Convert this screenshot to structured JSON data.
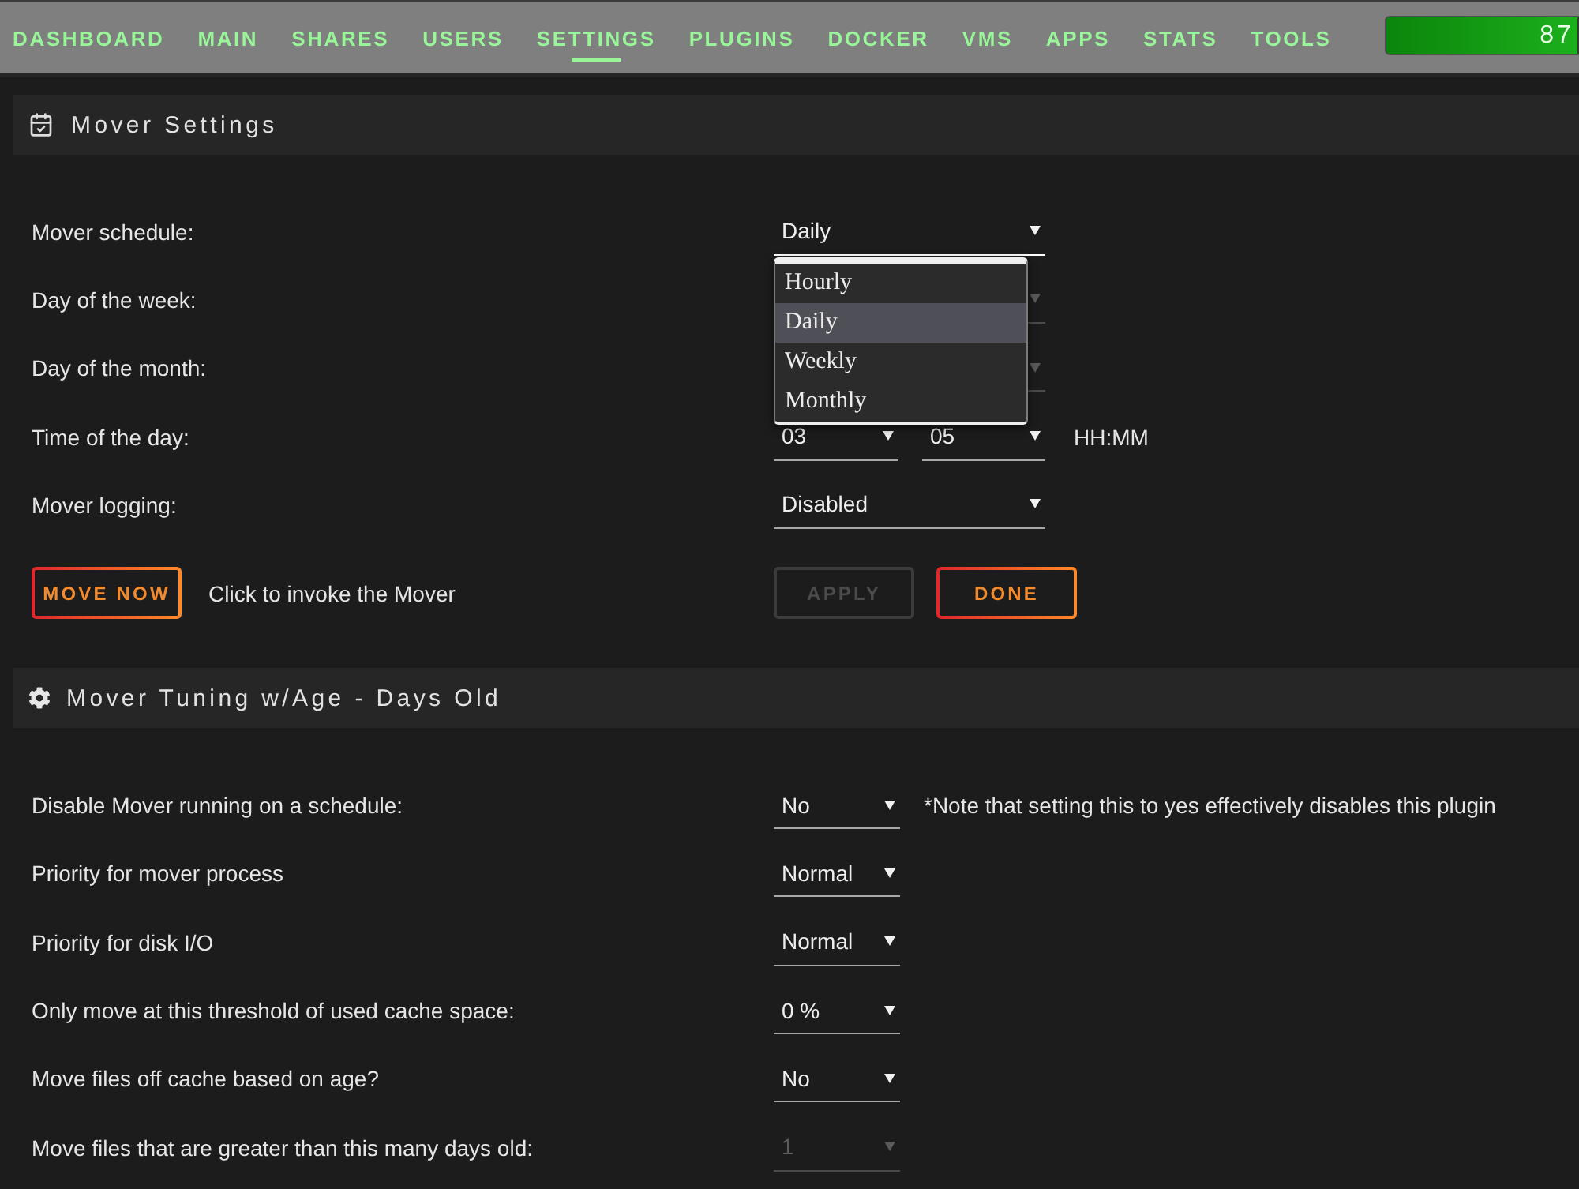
{
  "nav": {
    "items": [
      {
        "label": "DASHBOARD",
        "selected": false
      },
      {
        "label": "MAIN",
        "selected": false
      },
      {
        "label": "SHARES",
        "selected": false
      },
      {
        "label": "USERS",
        "selected": false
      },
      {
        "label": "SETTINGS",
        "selected": true
      },
      {
        "label": "PLUGINS",
        "selected": false
      },
      {
        "label": "DOCKER",
        "selected": false
      },
      {
        "label": "VMS",
        "selected": false
      },
      {
        "label": "APPS",
        "selected": false
      },
      {
        "label": "STATS",
        "selected": false
      },
      {
        "label": "TOOLS",
        "selected": false
      }
    ],
    "meter": {
      "label": "87",
      "level": 0.87
    }
  },
  "mover_settings": {
    "title": "Mover Settings",
    "rows": [
      {
        "kind": "select",
        "label": "Mover schedule:",
        "value": "Daily",
        "disabled": false,
        "expanded": true,
        "options": [
          {
            "label": "Hourly",
            "selected": false
          },
          {
            "label": "Daily",
            "selected": true
          },
          {
            "label": "Weekly",
            "selected": false
          },
          {
            "label": "Monthly",
            "selected": false
          }
        ]
      },
      {
        "kind": "select",
        "label": "Day of the week:",
        "disabled": true,
        "expanded": false
      },
      {
        "kind": "select",
        "label": "Day of the month:",
        "disabled": true,
        "expanded": false
      },
      {
        "kind": "time",
        "label": "Time of the day:",
        "hour": "03",
        "minute": "05",
        "format": "HH:MM"
      },
      {
        "kind": "select",
        "label": "Mover logging:",
        "value": "Disabled",
        "disabled": false,
        "expanded": false
      }
    ],
    "move_button": {
      "label": "MOVE NOW",
      "disabled": false
    },
    "move_hint": "Click to invoke the Mover",
    "buttons": [
      {
        "label": "APPLY",
        "disabled": true
      },
      {
        "label": "DONE",
        "disabled": false
      }
    ]
  },
  "mover_tuning": {
    "title": "Mover Tuning w/Age - Days Old",
    "rows": [
      {
        "label": "Disable Mover running on a schedule:",
        "value": "No",
        "disabled": false,
        "note": "*Note that setting this to yes effectively disables this plugin"
      },
      {
        "label": "Priority for mover process",
        "value": "Normal",
        "disabled": false
      },
      {
        "label": "Priority for disk I/O",
        "value": "Normal",
        "disabled": false
      },
      {
        "label": "Only move at this threshold of used cache space:",
        "value": "0 %",
        "disabled": false
      },
      {
        "label": "Move files off cache based on age?",
        "value": "No",
        "disabled": false
      },
      {
        "label": "Move files that are greater than this many days old:",
        "value": "1",
        "disabled": true
      }
    ]
  }
}
